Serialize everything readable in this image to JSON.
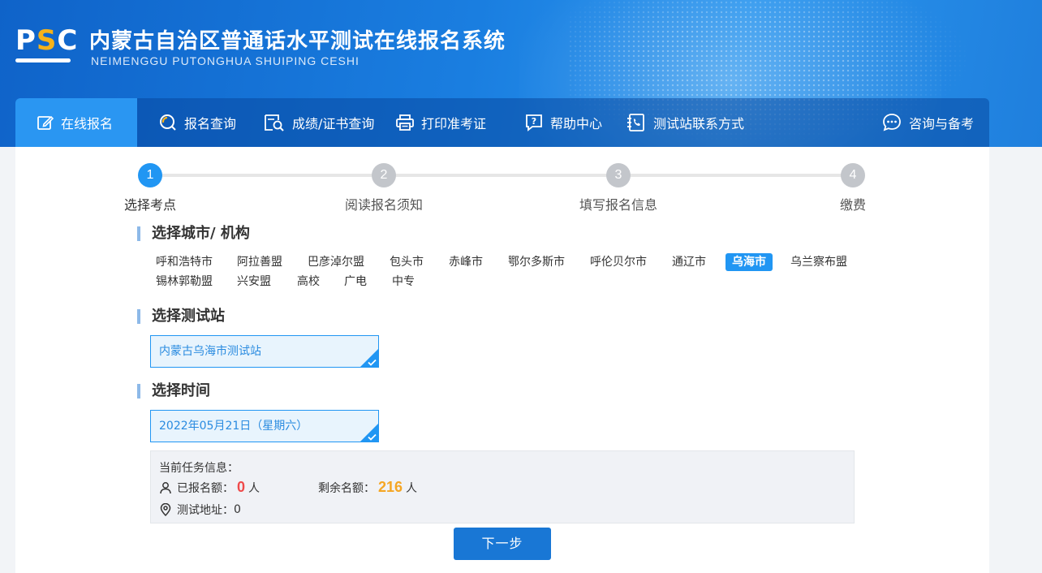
{
  "header": {
    "logo_text": "PSC",
    "title": "内蒙古自治区普通话水平测试在线报名系统",
    "subtitle": "NEIMENGGU PUTONGHUA SHUIPING CESHI"
  },
  "nav": {
    "items": [
      {
        "label": "在线报名",
        "icon": "edit-icon",
        "active": true
      },
      {
        "label": "报名查询",
        "icon": "search-circle-icon"
      },
      {
        "label": "成绩/证书查询",
        "icon": "document-search-icon"
      },
      {
        "label": "打印准考证",
        "icon": "printer-icon"
      },
      {
        "label": "帮助中心",
        "icon": "help-icon"
      },
      {
        "label": "测试站联系方式",
        "icon": "phone-book-icon"
      }
    ],
    "consult_label": "咨询与备考"
  },
  "steps": [
    {
      "num": "1",
      "label": "选择考点",
      "active": true
    },
    {
      "num": "2",
      "label": "阅读报名须知"
    },
    {
      "num": "3",
      "label": "填写报名信息"
    },
    {
      "num": "4",
      "label": "缴费"
    }
  ],
  "sections": {
    "city_title": "选择城市/ 机构",
    "station_title": "选择测试站",
    "time_title": "选择时间"
  },
  "cities": [
    "呼和浩特市",
    "阿拉善盟",
    "巴彦淖尔盟",
    "包头市",
    "赤峰市",
    "鄂尔多斯市",
    "呼伦贝尔市",
    "通辽市",
    "乌海市",
    "乌兰察布盟",
    "锡林郭勒盟",
    "兴安盟",
    "高校",
    "广电",
    "中专"
  ],
  "selected_city": "乌海市",
  "station": {
    "value": "内蒙古乌海市测试站"
  },
  "time": {
    "value": "2022年05月21日（星期六）"
  },
  "task_info": {
    "heading": "当前任务信息：",
    "registered_label": "已报名额：",
    "registered_count": "0",
    "registered_unit": "人",
    "remaining_label": "剩余名额：",
    "remaining_count": "216",
    "remaining_unit": "人",
    "address_label": "测试地址：",
    "address_value": "0"
  },
  "next_button": "下一步",
  "colors": {
    "primary": "#2196f3",
    "button": "#1977d5",
    "red": "#ef4a4a",
    "orange": "#f5a623"
  }
}
